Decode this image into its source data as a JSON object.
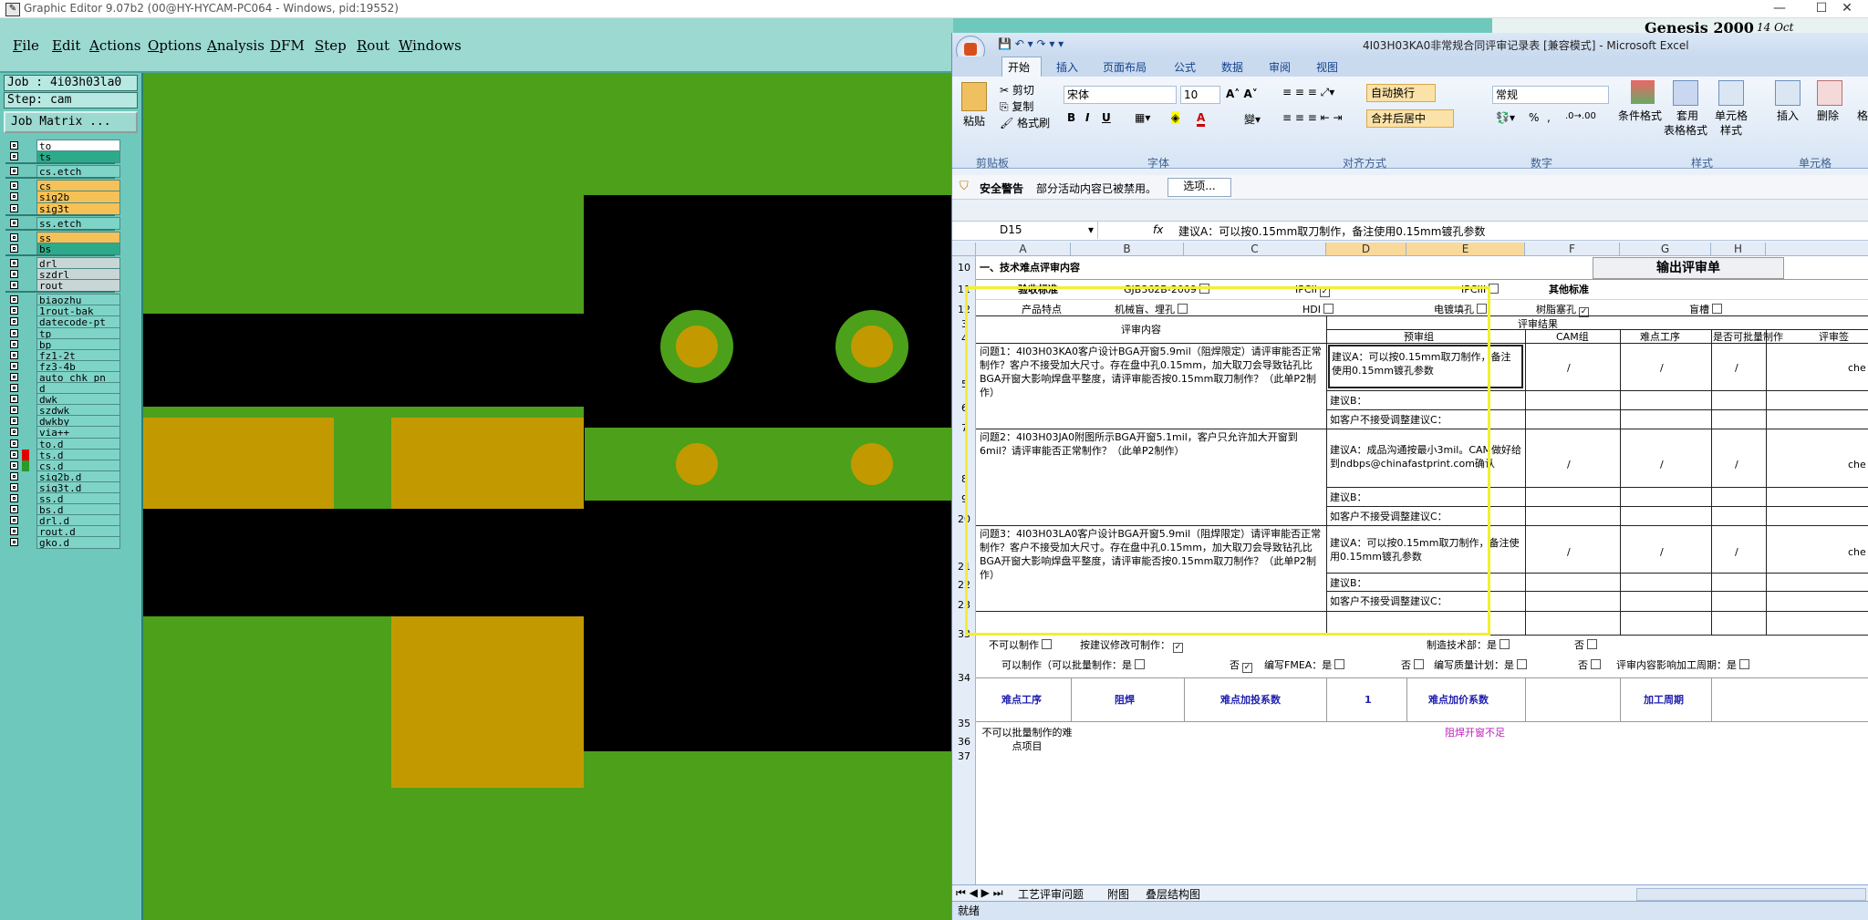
{
  "window": {
    "title": "Graphic Editor 9.07b2 (00@HY-HYCAM-PC064 - Windows, pid:19552)",
    "minimize": "—",
    "maximize": "☐",
    "close": "✕"
  },
  "menu": [
    "File",
    "Edit",
    "Actions",
    "Options",
    "Analysis",
    "DFM",
    "Step",
    "Rout",
    "Windows"
  ],
  "left": {
    "job": "Job : 4i03h03la0",
    "step": "Step: cam",
    "job_matrix": "Job Matrix ..."
  },
  "layers": [
    {
      "name": "to",
      "color": "#ffffff"
    },
    {
      "name": "ts",
      "color": "#2daa8a"
    },
    {
      "name": "cs.etch",
      "color": "#7fd4c8"
    },
    {
      "name": "cs",
      "color": "#f6c257"
    },
    {
      "name": "sig2b",
      "color": "#f6c257"
    },
    {
      "name": "sig3t",
      "color": "#f6c257"
    },
    {
      "name": "ss.etch",
      "color": "#7fd4c8"
    },
    {
      "name": "ss",
      "color": "#f6c257"
    },
    {
      "name": "bs",
      "color": "#2daa8a"
    },
    {
      "name": "drl",
      "color": "#c9d6d6"
    },
    {
      "name": "szdrl",
      "color": "#c9d6d6"
    },
    {
      "name": "rout",
      "color": "#c9d6d6"
    },
    {
      "name": "biaozhu",
      "color": "#7fd4c8"
    },
    {
      "name": "1rout-bak",
      "color": "#7fd4c8"
    },
    {
      "name": "datecode-pt",
      "color": "#7fd4c8"
    },
    {
      "name": "tp",
      "color": "#7fd4c8"
    },
    {
      "name": "bp",
      "color": "#7fd4c8"
    },
    {
      "name": "fz1-2t",
      "color": "#7fd4c8"
    },
    {
      "name": "fz3-4b",
      "color": "#7fd4c8"
    },
    {
      "name": "auto_chk_pn",
      "color": "#7fd4c8"
    },
    {
      "name": "d",
      "color": "#7fd4c8"
    },
    {
      "name": "dwk",
      "color": "#7fd4c8"
    },
    {
      "name": "szdwk",
      "color": "#7fd4c8"
    },
    {
      "name": "dwkby",
      "color": "#7fd4c8"
    },
    {
      "name": "via++",
      "color": "#7fd4c8"
    },
    {
      "name": "to.d",
      "color": "#7fd4c8"
    },
    {
      "name": "ts.d",
      "color": "#7fd4c8"
    },
    {
      "name": "cs.d",
      "color": "#7fd4c8"
    },
    {
      "name": "sig2b.d",
      "color": "#7fd4c8"
    },
    {
      "name": "sig3t.d",
      "color": "#7fd4c8"
    },
    {
      "name": "ss.d",
      "color": "#7fd4c8"
    },
    {
      "name": "bs.d",
      "color": "#7fd4c8"
    },
    {
      "name": "drl.d",
      "color": "#7fd4c8"
    },
    {
      "name": "rout.d",
      "color": "#7fd4c8"
    },
    {
      "name": "gko.d",
      "color": "#7fd4c8"
    }
  ],
  "genesis_banner": "Genesis 2000",
  "genesis_date": "14 Oct",
  "excel": {
    "title": "4I03H03KA0非常规合同评审记录表  [兼容模式] - Microsoft Excel",
    "tabs": [
      "开始",
      "插入",
      "页面布局",
      "公式",
      "数据",
      "审阅",
      "视图"
    ],
    "ribbon": {
      "paste": "粘贴",
      "cut": "剪切",
      "copy": "复制",
      "format_painter": "格式刷",
      "font_name": "宋体",
      "font_size": "10",
      "wrap": "自动换行",
      "merge": "合并后居中",
      "number_format": "常规",
      "percent": "%",
      "comma": ",",
      "cond_format": "条件格式",
      "table_format": "套用",
      "table_format2": "表格格式",
      "cell_style": "单元格",
      "cell_style2": "样式",
      "insert": "插入",
      "delete": "删除",
      "format": "格",
      "groups": [
        "剪贴板",
        "字体",
        "对齐方式",
        "数字",
        "样式",
        "单元格"
      ]
    },
    "security": {
      "label": "安全警告",
      "message": "部分活动内容已被禁用。",
      "options": "选项..."
    },
    "namebox": "D15",
    "fx": "fx",
    "formula": "建议A：可以按0.15mm取刀制作，备注使用0.15mm镀孔参数",
    "columns": [
      "A",
      "B",
      "C",
      "D",
      "E",
      "F",
      "G",
      "H"
    ],
    "output_button": "输出评审单",
    "rows": {
      "r10": "一、技术难点评审内容",
      "r11": [
        "验收标准",
        "GJB362B-2009",
        "IPCII",
        "IPCIII",
        "其他标准"
      ],
      "r12": [
        "产品特点",
        "机械盲、埋孔",
        "HDI",
        "电镀填孔",
        "树脂塞孔",
        "盲槽"
      ],
      "review_results": "评审结果",
      "review_content": "评审内容",
      "precheck": "预审组",
      "cam": "CAM组",
      "difficult": "难点工序",
      "batch": "是否可批量制作",
      "sign": "评审签",
      "q1": "问题1：4I03H03KA0客户设计BGA开窗5.9mil（阻焊限定）请评审能否正常制作？客户不接受加大尺寸。存在盘中孔0.15mm，加大取刀会导致钻孔比BGA开窗大影响焊盘平整度，请评审能否按0.15mm取刀制作？（此单P2制作）",
      "a1": "建议A：可以按0.15mm取刀制作，备注使用0.15mm镀孔参数",
      "b": "建议B：",
      "c": "如客户不接受调整建议C：",
      "q2": "问题2：4I03H03JA0附图所示BGA开窗5.1mil，客户只允许加大开窗到6mil？请评审能否正常制作？（此单P2制作）",
      "a2": "建议A：成品沟通按最小3mil。CAM做好给到ndbps@chinafastprint.com确认",
      "q3": "问题3：4I03H03LA0客户设计BGA开窗5.9mil（阻焊限定）请评审能否正常制作？客户不接受加大尺寸。存在盘中孔0.15mm，加大取刀会导致钻孔比BGA开窗大影响焊盘平整度，请评审能否按0.15mm取刀制作？（此单P2制作）",
      "a3": "建议A：可以按0.15mm取刀制作，备注使用0.15mm镀孔参数",
      "slash": "/",
      "che": "che",
      "r33a": "不可以制作",
      "r33b": "按建议修改可制作：",
      "r33c": "制造技术部：是",
      "r33d": "否",
      "r34": [
        "可以制作（可以批量制作：是",
        "否",
        "编写FMEA：是",
        "否",
        "编写质量计划：是",
        "否",
        "评审内容影响加工周期：是"
      ],
      "r35": [
        "难点工序",
        "阻焊",
        "难点加投系数",
        "1",
        "难点加价系数",
        "",
        "加工周期"
      ],
      "r36a": "不可以批量制作的难点项目",
      "r36b": "阻焊开窗不足",
      "row_numbers": [
        "10",
        "11",
        "12",
        "3",
        "4",
        "5",
        "6",
        "7",
        "8",
        "9",
        "20",
        "21",
        "22",
        "23",
        "33",
        "34",
        "35",
        "36",
        "37"
      ]
    },
    "sheet_tabs": [
      "工艺评审问题",
      "附图",
      "叠层结构图"
    ],
    "status": "就绪"
  }
}
